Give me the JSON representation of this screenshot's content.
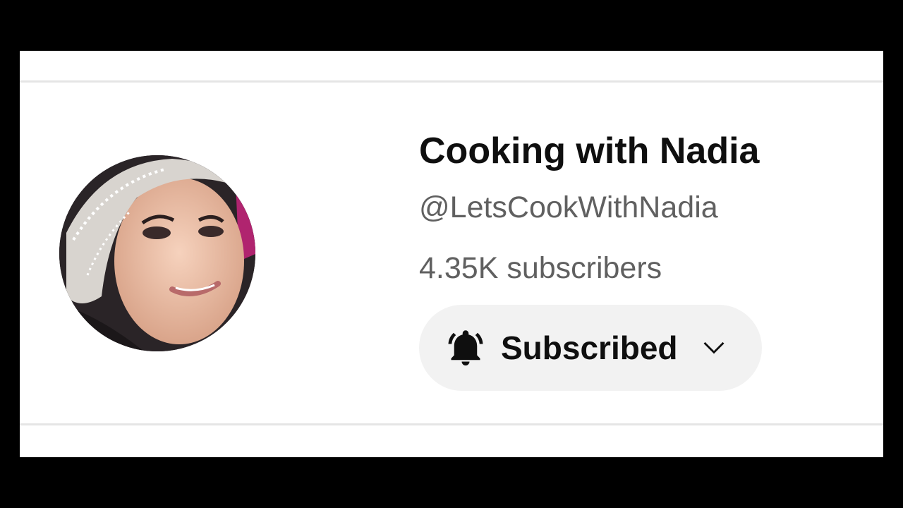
{
  "channel": {
    "name": "Cooking with Nadia",
    "handle": "@LetsCookWithNadia",
    "subscribers": "4.35K subscribers"
  },
  "subscribe_button": {
    "label": "Subscribed",
    "icon": "bell-icon",
    "dropdown_icon": "chevron-down-icon"
  },
  "avatar": {
    "icon": "avatar"
  },
  "colors": {
    "frame_bg": "#ffffff",
    "outer_bg": "#000000",
    "primary_text": "#0f0f0f",
    "secondary_text": "#606060",
    "button_bg": "#f2f2f2",
    "divider": "#e5e5e5"
  }
}
